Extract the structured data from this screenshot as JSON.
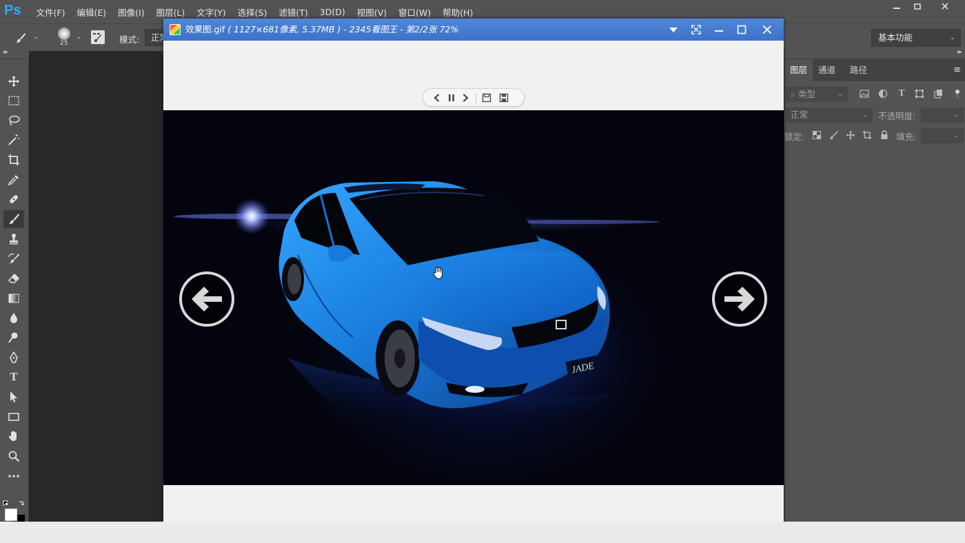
{
  "photoshop": {
    "logo": "Ps",
    "menu": [
      "文件(F)",
      "编辑(E)",
      "图像(I)",
      "图层(L)",
      "文字(Y)",
      "选择(S)",
      "滤镜(T)",
      "3D(D)",
      "视图(V)",
      "窗口(W)",
      "帮助(H)"
    ],
    "options_bar": {
      "brush_size": "25",
      "mode_label": "模式:",
      "mode_value": "正常",
      "workspace": "基本功能"
    },
    "panels": {
      "tabs": [
        "图层",
        "通道",
        "路径"
      ],
      "active_tab": "图层",
      "filter_kind": "类型",
      "blend_mode": "正常",
      "opacity_label": "不透明度:",
      "lock_label": "锁定:",
      "fill_label": "填充:"
    },
    "tools": [
      "move-icon",
      "marquee-icon",
      "lasso-icon",
      "magic-wand-icon",
      "crop-icon",
      "eyedropper-icon",
      "healing-icon",
      "brush-icon",
      "stamp-icon",
      "history-brush-icon",
      "eraser-icon",
      "gradient-icon",
      "blur-icon",
      "dodge-icon",
      "pen-icon",
      "type-icon",
      "path-select-icon",
      "rectangle-icon",
      "hand-icon",
      "zoom-icon",
      "more-icon"
    ],
    "active_tool": "brush-icon",
    "type_tool_glyph": "T",
    "colors": {
      "ui_bg": "#535353",
      "canvas_bg": "#282828",
      "accent": "#31a8ff"
    }
  },
  "viewer": {
    "title_name": "效果图.gif",
    "title_detail": " ( 1127×681像素, 5.37MB ) - 2345看图王 - 第2/2张 72%",
    "image_brand_text": "JADE",
    "colors": {
      "titlebar": "#4a7fd4",
      "car_blue": "#1a7fe0"
    }
  }
}
